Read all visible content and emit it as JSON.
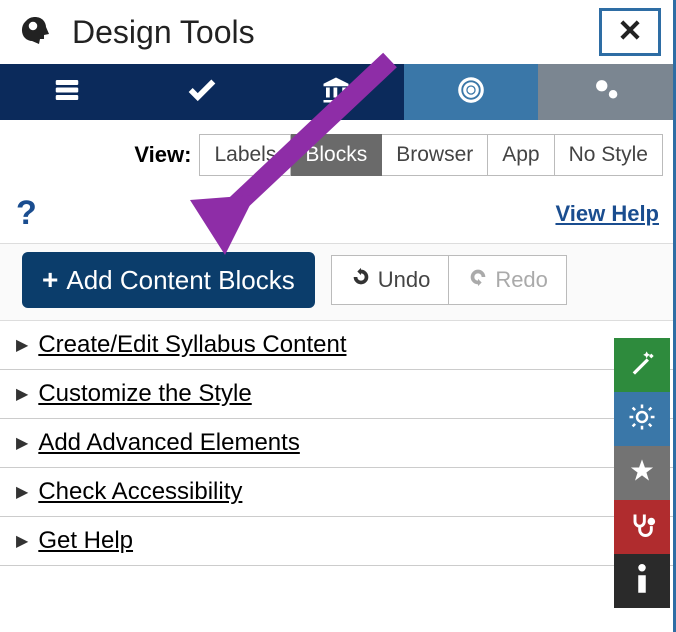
{
  "header": {
    "title": "Design Tools"
  },
  "view": {
    "label": "View:",
    "options": [
      "Labels",
      "Blocks",
      "Browser",
      "App",
      "No Style"
    ],
    "active": "Blocks"
  },
  "help": {
    "link_label": "View Help"
  },
  "actions": {
    "add_label": "Add Content Blocks",
    "undo_label": "Undo",
    "redo_label": "Redo"
  },
  "accordion": [
    "Create/Edit Syllabus Content",
    "Customize the Style",
    "Add Advanced Elements",
    "Check Accessibility",
    "Get Help"
  ],
  "side_tools": [
    "wand",
    "sun",
    "star",
    "stethoscope",
    "info"
  ],
  "colors": {
    "accent": "#0b2a5b",
    "arrow": "#8e2da7"
  }
}
